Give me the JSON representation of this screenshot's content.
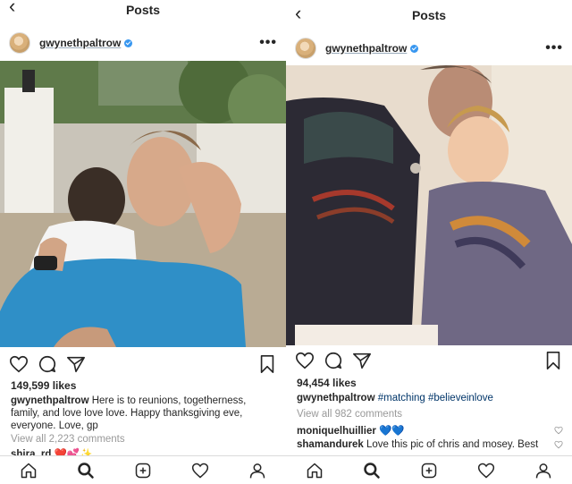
{
  "left": {
    "header": {
      "back": "‹",
      "title": "Posts"
    },
    "user": {
      "name": "gwynethpaltrow",
      "more": "•••"
    },
    "likes": "149,599 likes",
    "caption": {
      "user": "gwynethpaltrow",
      "text": " Here is to reunions, togetherness, family, and love love love. Happy thanksgiving eve, everyone. Love, gp"
    },
    "view_all": "View all 2,223 comments",
    "comment": {
      "user": "shira_rd",
      "text": " ❤️💕✨"
    }
  },
  "right": {
    "header": {
      "back": "‹",
      "title": "Posts"
    },
    "user": {
      "name": "gwynethpaltrow",
      "more": "•••"
    },
    "likes": "94,454 likes",
    "caption": {
      "user": "gwynethpaltrow",
      "tag1": "#matching",
      "tag2": "#believeinlove"
    },
    "view_all": "View all 982 comments",
    "comments": [
      {
        "user": "moniquelhuillier",
        "text": " 💙💙"
      },
      {
        "user": "shamandurek",
        "text": " Love this pic of chris and mosey. Best"
      }
    ]
  },
  "icons": {
    "action": [
      "heart-icon",
      "comment-icon",
      "share-icon",
      "bookmark-icon"
    ],
    "tabs": [
      "home-icon",
      "search-icon",
      "add-icon",
      "activity-icon",
      "profile-icon"
    ]
  },
  "colors": {
    "verified": "#3897f0",
    "hashtag": "#003569",
    "muted": "#999999",
    "text": "#262626"
  }
}
